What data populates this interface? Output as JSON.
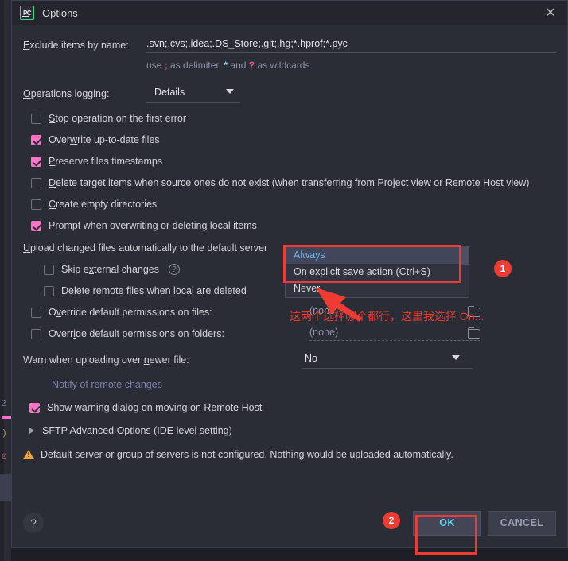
{
  "window": {
    "title": "Options",
    "app_icon": "pycharm-pc-icon",
    "close_icon": "close-icon"
  },
  "form": {
    "exclude": {
      "label": "Exclude items by name:",
      "value": ".svn;.cvs;.idea;.DS_Store;.git;.hg;*.hprof;*.pyc",
      "hint_part1": "use ",
      "hint_semicolon": ";",
      "hint_part2": " as delimiter, ",
      "hint_star": "*",
      "hint_part3": " and ",
      "hint_question": "?",
      "hint_part4": " as wildcards"
    },
    "operations_logging": {
      "label": "Operations logging:",
      "value": "Details",
      "options": [
        "Details"
      ]
    },
    "checkboxes": [
      {
        "label": "Stop operation on the first error",
        "checked": false
      },
      {
        "label": "Overwrite up-to-date files",
        "checked": true
      },
      {
        "label": "Preserve files timestamps",
        "checked": true
      },
      {
        "label": "Delete target items when source ones do not exist (when transferring from Project view or Remote Host view)",
        "checked": false
      },
      {
        "label": "Create empty directories",
        "checked": false
      },
      {
        "label": "Prompt when overwriting or deleting local items",
        "checked": true
      }
    ],
    "upload_label": "Upload changed files automatically to the default server",
    "upload_options": [
      "Always",
      "On explicit save action (Ctrl+S)",
      "Never"
    ],
    "upload_selected": "Always",
    "sub_checkboxes": [
      {
        "label": "Skip external changes",
        "checked": false,
        "has_help": true
      },
      {
        "label": "Delete remote files when local are deleted",
        "checked": false,
        "has_help": false
      }
    ],
    "permissions": [
      {
        "label": "Override default permissions on files:",
        "checked": false,
        "value": "(none)"
      },
      {
        "label": "Override default permissions on folders:",
        "checked": false,
        "value": "(none)"
      }
    ],
    "warn_newer": {
      "label": "Warn when uploading over newer file:",
      "value": "No",
      "options": [
        "No"
      ]
    },
    "notify_link": "Notify of remote changes",
    "show_warning": {
      "label": "Show warning dialog on moving on Remote Host",
      "checked": true
    },
    "sftp_advanced": "SFTP Advanced Options (IDE level setting)",
    "alert": "Default server or group of servers is not configured. Nothing would be uploaded automatically."
  },
  "footer": {
    "help_label": "?",
    "ok_label": "OK",
    "cancel_label": "CANCEL"
  },
  "annotations": {
    "badge1": "1",
    "badge2": "2",
    "note": "这两个选择哪个都行，这里我选择 On..."
  },
  "colors": {
    "accent_pink": "#ff72c6",
    "annotation_red": "#ee3b33",
    "ok_cyan": "#5fd0ef",
    "warning_orange": "#f2a33c",
    "link_blue": "#7b84a8",
    "dialog_bg": "#2b2d36"
  },
  "background_editor": {
    "line_number": "2",
    "token": "0"
  }
}
